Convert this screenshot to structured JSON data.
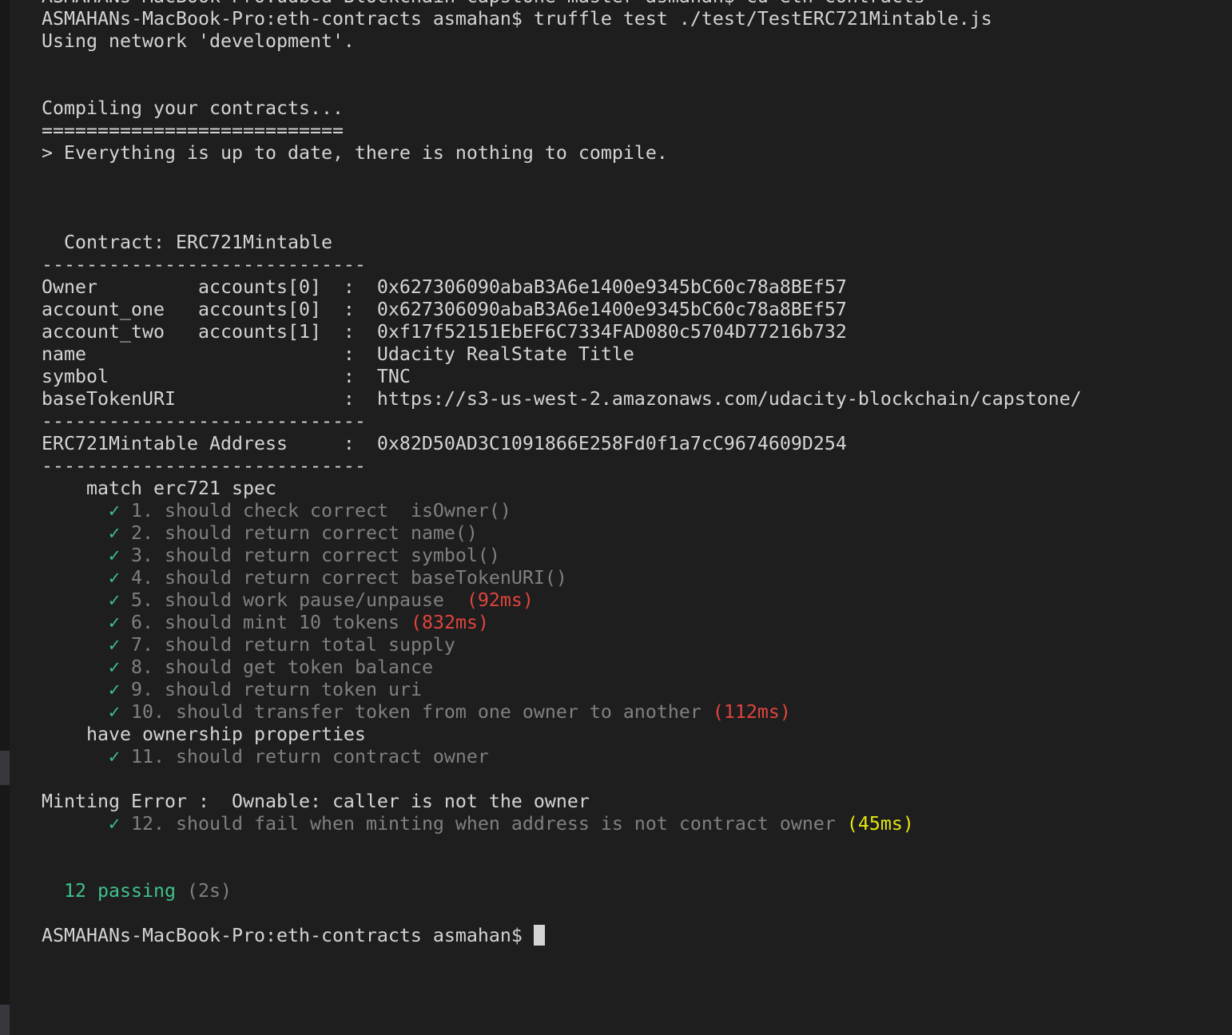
{
  "terminal": {
    "prev_command": "ASMAHANs-MacBook-Pro:udbed Blockchain capstone-master asmahan$ cd eth-contracts",
    "command_line": "ASMAHANs-MacBook-Pro:eth-contracts asmahan$ truffle test ./test/TestERC721Mintable.js",
    "network_line": "Using network 'development'.",
    "compiling": "Compiling your contracts...",
    "compile_rule": "===========================",
    "compile_result": "> Everything is up to date, there is nothing to compile.",
    "contract_header": "  Contract: ERC721Mintable",
    "rule": "-----------------------------",
    "info_rows": [
      "Owner         accounts[0]  :  0x627306090abaB3A6e1400e9345bC60c78a8BEf57",
      "account_one   accounts[0]  :  0x627306090abaB3A6e1400e9345bC60c78a8BEf57",
      "account_two   accounts[1]  :  0xf17f52151EbEF6C7334FAD080c5704D77216b732",
      "name                       :  Udacity RealState Title",
      "symbol                     :  TNC",
      "baseTokenURI               :  https://s3-us-west-2.amazonaws.com/udacity-blockchain/capstone/"
    ],
    "address_row": "ERC721Mintable Address     :  0x82D50AD3C1091866E258Fd0f1a7cC9674609D254",
    "suite1": "    match erc721 spec",
    "suite2": "    have ownership properties",
    "check": "✓",
    "tests": [
      {
        "text": "1. should check correct  isOwner()",
        "time": ""
      },
      {
        "text": "2. should return correct name()",
        "time": ""
      },
      {
        "text": "3. should return correct symbol()",
        "time": ""
      },
      {
        "text": "4. should return correct baseTokenURI()",
        "time": ""
      },
      {
        "text": "5. should work pause/unpause  ",
        "time": "(92ms)"
      },
      {
        "text": "6. should mint 10 tokens ",
        "time": "(832ms)"
      },
      {
        "text": "7. should return total supply",
        "time": ""
      },
      {
        "text": "8. should get token balance",
        "time": ""
      },
      {
        "text": "9. should return token uri",
        "time": ""
      },
      {
        "text": "10. should transfer token from one owner to another ",
        "time": "(112ms)"
      },
      {
        "text": "11. should return contract owner",
        "time": ""
      },
      {
        "text": "12. should fail when minting when address is not contract owner ",
        "time": "(45ms)"
      }
    ],
    "minting_error": "Minting Error :  Ownable: caller is not the owner",
    "passing": "12 passing",
    "duration": " (2s)",
    "prompt": "ASMAHANs-MacBook-Pro:eth-contracts asmahan$ ",
    "colors": {
      "background": "#1e1e1e",
      "pass": "#3fc28a",
      "slow": "#e0443e",
      "medium": "#e5e510"
    }
  }
}
